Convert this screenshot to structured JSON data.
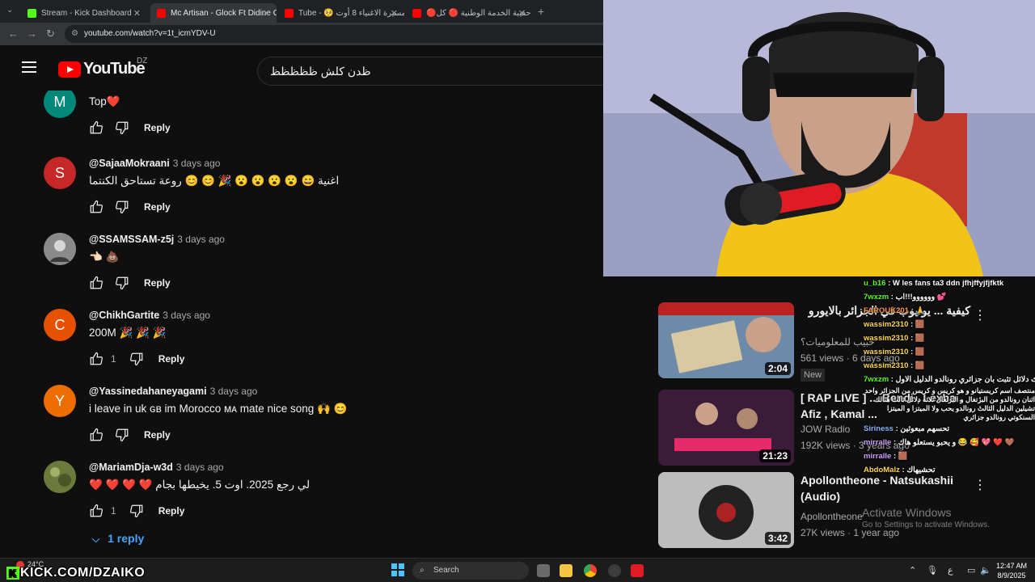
{
  "browser": {
    "tabs": [
      {
        "label": "Stream - Kick Dashboard",
        "active": false,
        "color": "#53fc18"
      },
      {
        "label": "Mc Artisan - Glock Ft Didine Ca",
        "active": true,
        "color": "#ff0000"
      },
      {
        "label": "Tube - 🥺 مسيرة الاغنياء 8 أوت",
        "active": false,
        "color": "#ff0000"
      },
      {
        "label": "🔴حقيبة الخدمة الوطنية 🔴 كل",
        "active": false,
        "color": "#ff0000"
      }
    ],
    "url": "youtube.com/watch?v=1t_icmYDV-U"
  },
  "header": {
    "logo_text": "YouTube",
    "country": "DZ",
    "search_value": "ظدن كلش ظظظظظ"
  },
  "comments": [
    {
      "author": "",
      "time": "",
      "text": "Top❤️",
      "avatar_letter": "M",
      "avatar_color": "#00897b",
      "likes": "",
      "reply_label": "Reply"
    },
    {
      "author": "@SajaaMokraani",
      "time": "3 days ago",
      "text": "اغنية 😄 😮 😮 😮 😮 🎉 😊 😊 روعة تستاحق الكنتما",
      "avatar_letter": "S",
      "avatar_color": "#c62828",
      "likes": "",
      "reply_label": "Reply"
    },
    {
      "author": "@SSAMSSAM-z5j",
      "time": "3 days ago",
      "text": "👈🏻 💩",
      "avatar_letter": "",
      "avatar_color": "#555555",
      "likes": "",
      "reply_label": "Reply"
    },
    {
      "author": "@ChikhGartite",
      "time": "3 days ago",
      "text": "200M 🎉 🎉 🎉",
      "avatar_letter": "C",
      "avatar_color": "#e65100",
      "likes": "1",
      "reply_label": "Reply"
    },
    {
      "author": "@Yassinedahaneyagami",
      "time": "3 days ago",
      "text": "i leave in uk ɢʙ im Morocco ᴍᴀ mate nice song 🙌 😊",
      "avatar_letter": "Y",
      "avatar_color": "#ef6c00",
      "likes": "",
      "reply_label": "Reply"
    },
    {
      "author": "@MariamDja-w3d",
      "time": "3 days ago",
      "text": "لي رجع 2025. اوت 5. يخيطها بجام ❤️ ❤️ ❤️ ❤️",
      "avatar_letter": "",
      "avatar_color": "#6b7a3a",
      "likes": "1",
      "reply_label": "Reply"
    }
  ],
  "view_replies": "1 reply",
  "sidebar_videos": [
    {
      "title": "كيفية ... يوتيوب في الجزائر بالايورو",
      "channel": "حبيب للمعلوميات؟",
      "meta": "561 views · 6 days ago",
      "badge": "New",
      "duration": "2:04",
      "thumb_color": "#5b6f8a"
    },
    {
      "title": "[ RAP LIVE ] ... Bendi , Lexha , Afiz , Kamal ...",
      "channel": "JOW Radio",
      "meta": "192K views · 3 years ago",
      "badge": "",
      "duration": "21:23",
      "thumb_color": "#7a1f3a"
    },
    {
      "title": "Apollontheone - Natsukashii (Audio)",
      "channel": "Apollontheone",
      "meta": "27K views · 1 year ago",
      "badge": "",
      "duration": "3:42",
      "thumb_color": "#9a9a9a"
    }
  ],
  "chat": [
    {
      "name": "u_b16",
      "text": "W les fans ta3 ddn jfhjffyjfjfktk"
    },
    {
      "name": "7wxzm",
      "text": "وووووو!!!اب 💕"
    },
    {
      "name": "FAROUK201",
      "text": "🙏"
    },
    {
      "name": "wassim2310",
      "text": "🟫"
    },
    {
      "name": "wassim2310",
      "text": "🟫"
    },
    {
      "name": "wassim2310",
      "text": "🟫"
    },
    {
      "name": "wassim2310",
      "text": "🟫"
    },
    {
      "name": "7wxzm",
      "text": "ثلاث دلائل تثبت بان جزائري رونالدو الدليل الاول"
    },
    {
      "name": "",
      "text": "منتصف اسم كريستيانو و هو كريس و كريس من الجزائر واحد اثنان رونالدو من البرتغال و البرتغال ثلاثة دلائل ثالث هنالك تشيلين الدليل الثالث رونالدو يحب ولا الميتزا و الميتزا السنكوتي رونالدو جزائري"
    },
    {
      "name": "Siriness",
      "text": "تحسهم مبعوثين"
    },
    {
      "name": "mirralle",
      "text": "و يحبو يستعلو هاك 😂 🥰 💖 ❤️ 🤎"
    },
    {
      "name": "mirralle",
      "text": "🟫"
    },
    {
      "name": "AbdoMalz",
      "text": "تحشيهاك"
    }
  ],
  "activate": {
    "title": "Activate Windows",
    "sub": "Go to Settings to activate Windows."
  },
  "kick_watermark": "KICK.COM/DZAIKO",
  "taskbar": {
    "weather": "24°C",
    "search_placeholder": "Search",
    "time": "12:47 AM",
    "date": "8/9/2025",
    "lang": "ع"
  }
}
